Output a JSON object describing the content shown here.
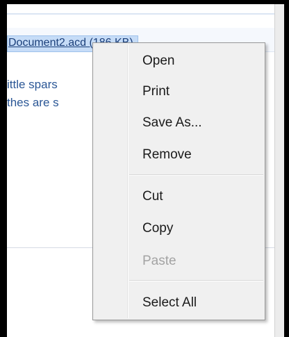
{
  "attachment": {
    "label": "Document2.acd (186 KB)"
  },
  "message": {
    "line1": "ittle spars",
    "line2": "thes are s"
  },
  "context_menu": {
    "group1": [
      {
        "label": "Open",
        "enabled": true
      },
      {
        "label": "Print",
        "enabled": true
      },
      {
        "label": "Save As...",
        "enabled": true
      },
      {
        "label": "Remove",
        "enabled": true
      }
    ],
    "group2": [
      {
        "label": "Cut",
        "enabled": true
      },
      {
        "label": "Copy",
        "enabled": true
      },
      {
        "label": "Paste",
        "enabled": false
      }
    ],
    "group3": [
      {
        "label": "Select All",
        "enabled": true
      }
    ]
  },
  "colors": {
    "link_text": "#1b3f7a",
    "selection_bg": "#c6dcf7",
    "body_text": "#2b5796",
    "menu_bg": "#f0f0f0",
    "disabled_text": "#a3a3a3"
  }
}
